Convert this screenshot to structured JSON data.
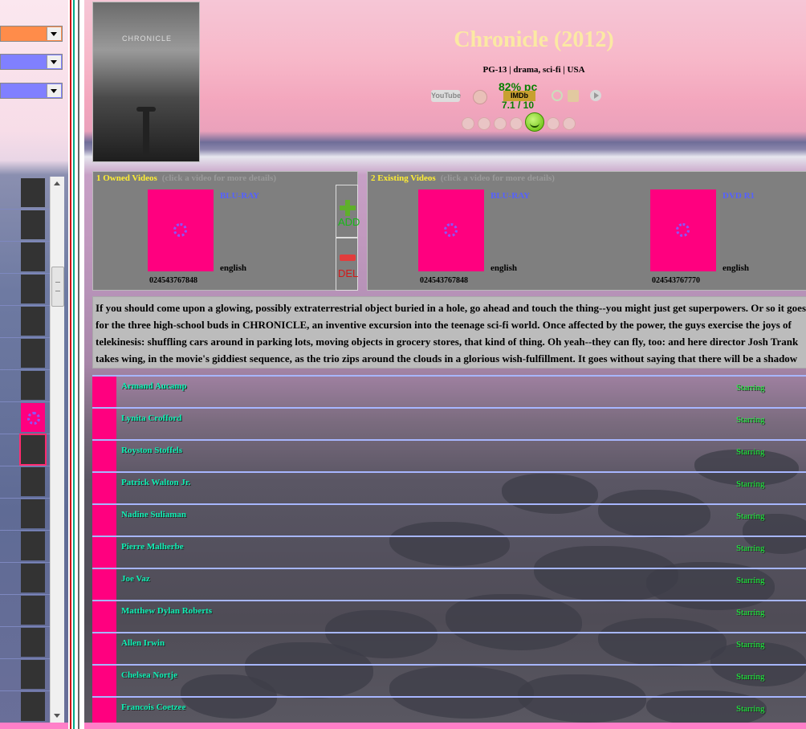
{
  "sidebar": {
    "filters": [
      {
        "color": "#ff8c4a",
        "value": ""
      },
      {
        "color": "#8080ff",
        "value": ""
      },
      {
        "color": "#8080ff",
        "value": ""
      }
    ],
    "thumb_count": 17,
    "selected_index": 8,
    "placeholder_index": 7
  },
  "movie": {
    "title": "Chronicle (2012)",
    "subtitle": "PG-13 | drama, sci-fi | USA",
    "poster_text": "CHRONICLE",
    "youtube_icon": "YouTube",
    "tomato_score": "82% pc",
    "imdb_label": "IMDb",
    "imdb_score": "7.1 / 10"
  },
  "owned": {
    "header": "1  Owned Videos",
    "hint": "(click a video for more details)",
    "videos": [
      {
        "format": "BLU-RAY",
        "language": "english",
        "code": "024543767848"
      }
    ],
    "add_label": "ADD",
    "del_label": "DEL"
  },
  "existing": {
    "header": "2  Existing Videos",
    "hint": "(click a video for more details)",
    "videos": [
      {
        "format": "BLU-RAY",
        "language": "english",
        "code": "024543767848"
      },
      {
        "format": "DVD R1",
        "language": "english",
        "code": "024543767770"
      }
    ]
  },
  "description": "If you should come upon a glowing, possibly extraterrestrial object buried in a hole, go ahead and touch the thing--you might just get superpowers. Or so it goes for the three high-school buds in CHRONICLE, an inventive excursion into the teenage sci-fi world. Once affected by the power, the guys exercise the joys of telekinesis: shuffling cars around in parking lots, moving objects in grocery stores, that kind of thing. Oh yeah--they can fly, too: and here director Josh Trank takes wing, in the movie's giddiest sequence, as the trio zips around the clouds in a glorious wish-fulfillment. It goes without saying that there will be a shadow",
  "cast": [
    {
      "name": "Armand Aucamp",
      "role": "Starring"
    },
    {
      "name": "Lynita Crofford",
      "role": "Starring"
    },
    {
      "name": "Royston Stoffels",
      "role": "Starring"
    },
    {
      "name": "Patrick Walton Jr.",
      "role": "Starring"
    },
    {
      "name": "Nadine Suliaman",
      "role": "Starring"
    },
    {
      "name": "Pierre Malherbe",
      "role": "Starring"
    },
    {
      "name": "Joe Vaz",
      "role": "Starring"
    },
    {
      "name": "Matthew Dylan Roberts",
      "role": "Starring"
    },
    {
      "name": "Allen Irwin",
      "role": "Starring"
    },
    {
      "name": "Chelsea Nortje",
      "role": "Starring"
    },
    {
      "name": "Francois Coetzee",
      "role": "Starring"
    }
  ],
  "colors": {
    "accent_pink": "#ff007f",
    "header_yellow": "#ffee33",
    "format_blue": "#5561ff",
    "cast_name": "#0ff0b5",
    "cast_role": "#16ff38"
  }
}
